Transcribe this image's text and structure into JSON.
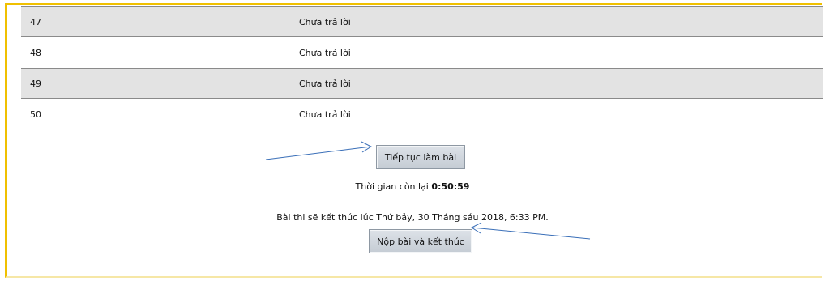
{
  "questions": [
    {
      "number": "47",
      "status": "Chưa trả lời",
      "shaded": true
    },
    {
      "number": "48",
      "status": "Chưa trả lời",
      "shaded": false
    },
    {
      "number": "49",
      "status": "Chưa trả lời",
      "shaded": true
    },
    {
      "number": "50",
      "status": "Chưa trả lời",
      "shaded": false
    }
  ],
  "actions": {
    "continue_label": "Tiếp tục làm bài",
    "submit_label": "Nộp bài và kết thúc"
  },
  "timer": {
    "label": "Thời gian còn lại ",
    "value": "0:50:59"
  },
  "end_notice": "Bài thi sẽ kết thúc lúc Thứ bảy, 30 Tháng sáu 2018, 6:33 PM.",
  "colors": {
    "frame_accent": "#f0c000",
    "row_shade": "#e3e3e3",
    "arrow": "#3a6fb8"
  }
}
